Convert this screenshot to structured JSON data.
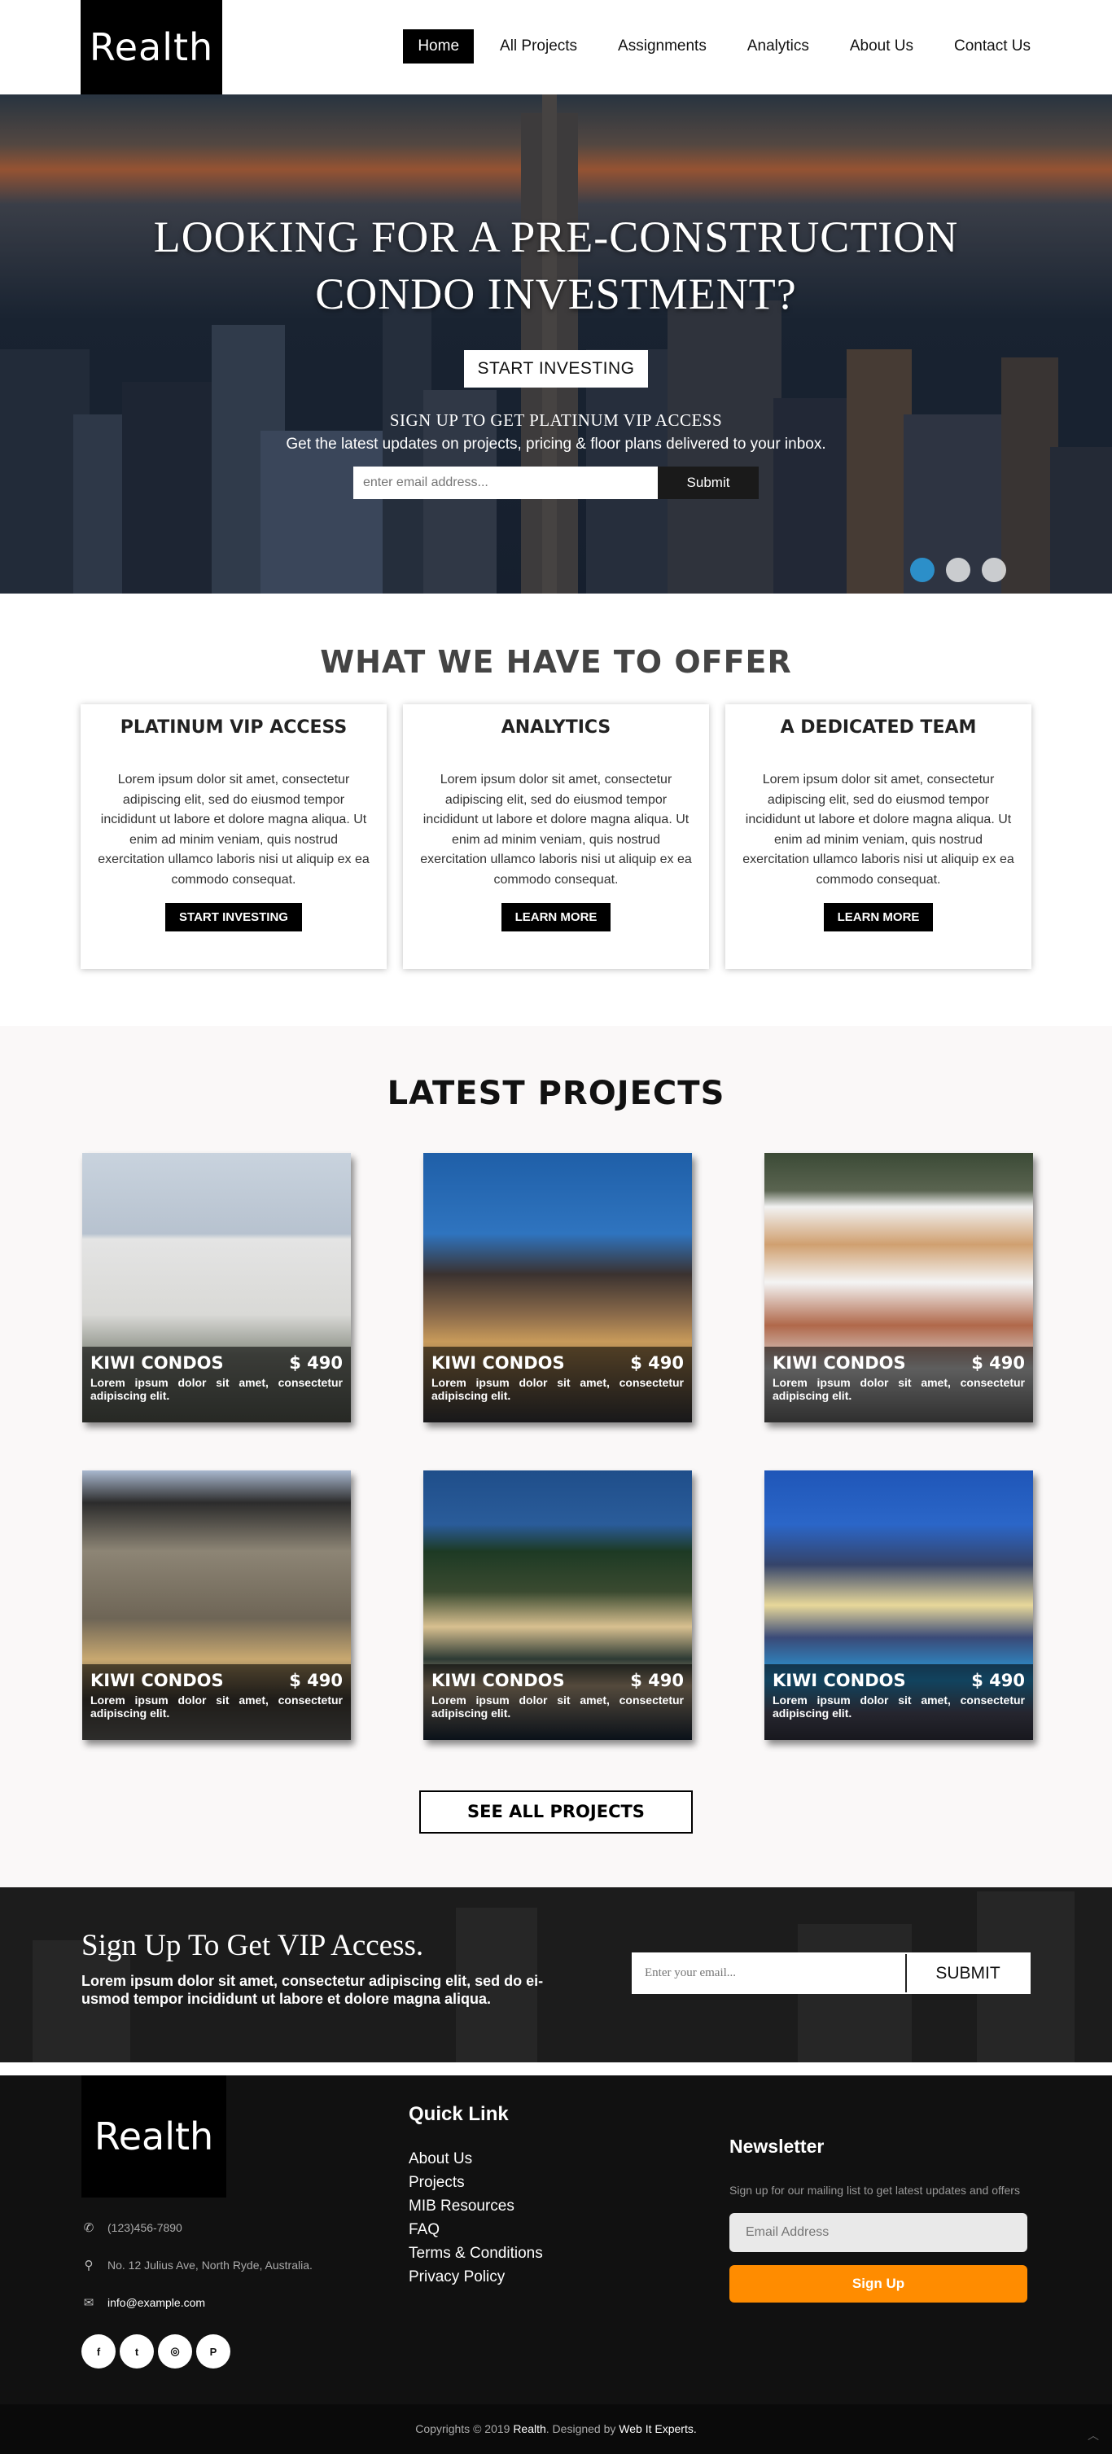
{
  "brand": {
    "logo": "Realth"
  },
  "nav": {
    "items": [
      {
        "label": "Home",
        "active": true
      },
      {
        "label": "All Projects"
      },
      {
        "label": "Assignments"
      },
      {
        "label": "Analytics"
      },
      {
        "label": "About Us"
      },
      {
        "label": "Contact Us"
      }
    ]
  },
  "hero": {
    "title_line1": "LOOKING FOR A PRE-CONSTRUCTION",
    "title_line2": "CONDO INVESTMENT?",
    "cta": "START INVESTING",
    "vip_title": "SIGN UP TO GET PLATINUM VIP ACCESS",
    "vip_sub": "Get the latest updates on projects, pricing & floor plans delivered to your inbox.",
    "email_placeholder": "enter email address...",
    "submit": "Submit"
  },
  "offer": {
    "title": "WHAT WE HAVE TO OFFER",
    "cards": [
      {
        "title": "PLATINUM VIP ACCESS",
        "text": "Lorem ipsum dolor sit amet, consectetur adipiscing elit, sed do eiusmod tempor incididunt ut labore et dolore magna aliqua. Ut enim ad minim veniam, quis nostrud exercitation ullamco laboris nisi ut aliquip ex ea commodo consequat.",
        "button": "START INVESTING"
      },
      {
        "title": "ANALYTICS",
        "text": "Lorem ipsum dolor sit amet, consectetur adipiscing elit, sed do eiusmod tempor incididunt ut labore et dolore magna aliqua. Ut enim ad minim veniam, quis nostrud exercitation ullamco laboris nisi ut aliquip ex ea commodo consequat.",
        "button": "LEARN MORE"
      },
      {
        "title": "A DEDICATED TEAM",
        "text": "Lorem ipsum dolor sit amet, consectetur adipiscing elit, sed do eiusmod tempor incididunt ut labore et dolore magna aliqua. Ut enim ad minim veniam, quis nostrud exercitation ullamco laboris nisi ut aliquip ex ea commodo consequat.",
        "button": "LEARN MORE"
      }
    ]
  },
  "projects": {
    "title": "LATEST PROJECTS",
    "items": [
      {
        "name": "KIWI CONDOS",
        "price": "$ 490",
        "desc": "Lorem ipsum dolor sit amet, consectetur adipiscing elit."
      },
      {
        "name": "KIWI CONDOS",
        "price": "$ 490",
        "desc": "Lorem ipsum dolor sit amet, consectetur adipiscing elit."
      },
      {
        "name": "KIWI CONDOS",
        "price": "$ 490",
        "desc": "Lorem ipsum dolor sit amet, consectetur adipiscing elit."
      },
      {
        "name": "KIWI CONDOS",
        "price": "$ 490",
        "desc": "Lorem ipsum dolor sit amet, consectetur adipiscing elit."
      },
      {
        "name": "KIWI CONDOS",
        "price": "$ 490",
        "desc": "Lorem ipsum dolor sit amet, consectetur adipiscing elit."
      },
      {
        "name": "KIWI CONDOS",
        "price": "$ 490",
        "desc": "Lorem ipsum dolor sit amet, consectetur adipiscing elit."
      }
    ],
    "see_all": "SEE ALL PROJECTS"
  },
  "signup": {
    "title": "Sign Up To Get VIP Access.",
    "text": "Lorem ipsum dolor sit amet, consectetur adipiscing elit, sed do ei- usmod tempor incididunt ut labore et dolore magna aliqua.",
    "placeholder": "Enter your email...",
    "button": "SUBMIT"
  },
  "footer": {
    "logo": "Realth",
    "phone": "(123)456-7890",
    "address": "No. 12 Julius Ave, North Ryde, Australia.",
    "email": "info@example.com",
    "socials": [
      "facebook-icon",
      "twitter-icon",
      "instagram-icon",
      "pinterest-icon"
    ],
    "quick_title": "Quick Link",
    "quick_links": [
      "About Us",
      "Projects",
      "MIB Resources",
      "FAQ",
      "Terms & Conditions",
      "Privacy Policy"
    ],
    "newsletter_title": "Newsletter",
    "newsletter_text": "Sign up for our mailing list to get latest updates and offers",
    "newsletter_placeholder": "Email Address",
    "newsletter_button": "Sign Up"
  },
  "copyright": {
    "prefix": "Copyrights © 2019",
    "brand": "Realth",
    "middle": ". Designed by",
    "designer": "Web It Experts."
  },
  "colors": {
    "accent": "#ff8c00",
    "dot_active": "#2c8fc9"
  }
}
